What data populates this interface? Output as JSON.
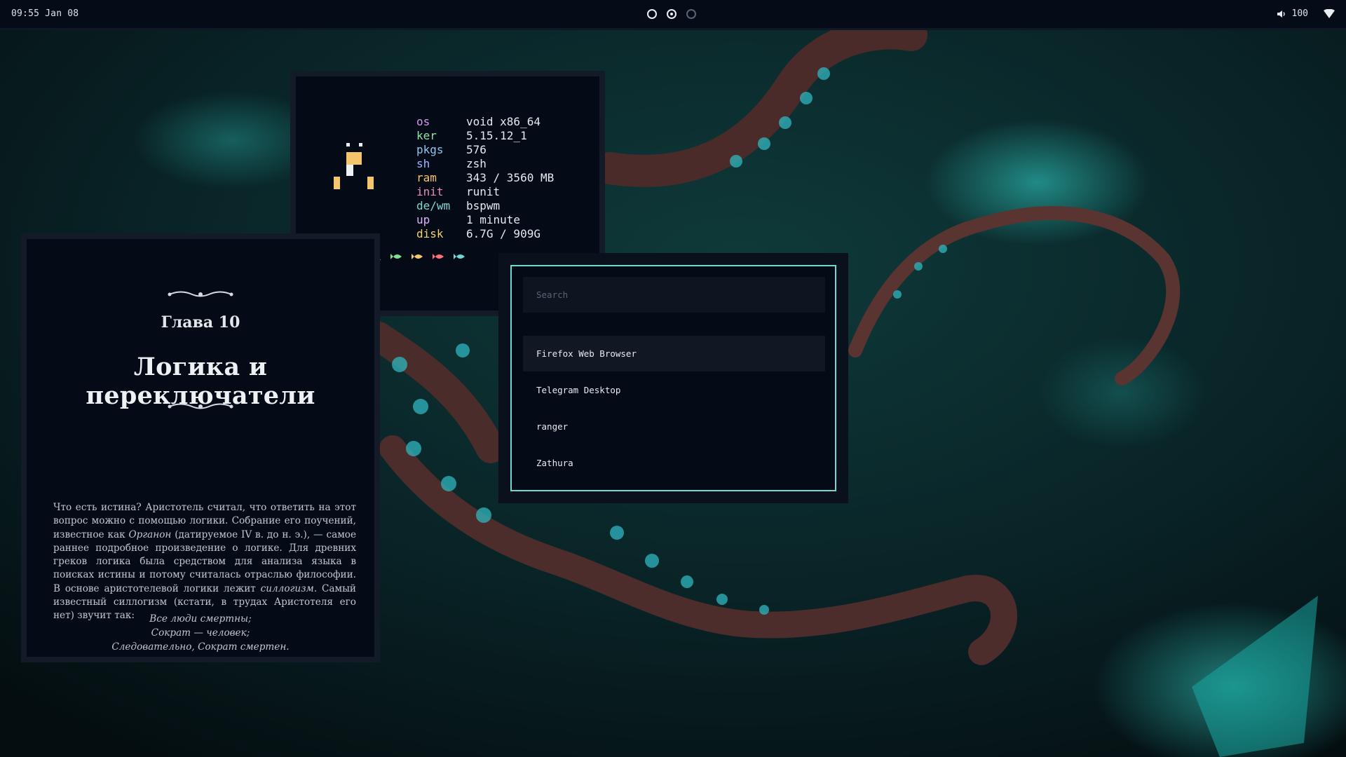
{
  "topbar": {
    "clock": "09:55 Jan 08",
    "volume": "100",
    "workspaces": [
      {
        "state": "occupied"
      },
      {
        "state": "active"
      },
      {
        "state": "empty"
      }
    ],
    "icons": {
      "volume": "speaker-icon",
      "network": "wifi-icon"
    }
  },
  "terminal": {
    "sysinfo": [
      {
        "key": "os",
        "value": "void x86_64"
      },
      {
        "key": "ker",
        "value": "5.15.12_1"
      },
      {
        "key": "pkgs",
        "value": "576"
      },
      {
        "key": "sh",
        "value": "zsh"
      },
      {
        "key": "ram",
        "value": "343 / 3560 MB"
      },
      {
        "key": "init",
        "value": "runit"
      },
      {
        "key": "de/wm",
        "value": "bspwm"
      },
      {
        "key": "up",
        "value": "1 minute"
      },
      {
        "key": "disk",
        "value": "6.7G / 909G"
      }
    ],
    "prompt_dir": "~",
    "prompt_symbol": "⚓",
    "fish_colors": [
      "#7fb3ff",
      "#7fe08f",
      "#f5c56e",
      "#ff6f7d",
      "#6fd8d2"
    ]
  },
  "document": {
    "chapter": "Глава 10",
    "title": "Логика и переключатели",
    "paragraph": {
      "p1": "Что есть истина? Аристотель считал, что ответить на этот вопрос можно с помощью логики. Собрание его поучений, известное как ",
      "em1": "Органон",
      "p2": " (датируемое IV в. до н. э.), — самое раннее подробное произведение о логике. Для древних греков логика была средством для анализа языка в поисках истины и потому считалась отраслью философии. В основе аристотелевой логики лежит ",
      "em2": "силлогизм",
      "p3": ". Самый известный силлогизм (кстати, в трудах Аристотеля его нет) звучит так:"
    },
    "verse": [
      "Все люди смертны;",
      "Сократ — человек;",
      "Следовательно, Сократ смертен."
    ]
  },
  "launcher": {
    "search_placeholder": "Search",
    "items": [
      "Firefox Web Browser",
      "Telegram Desktop",
      "ranger",
      "Zathura"
    ],
    "selected_index": 0,
    "accent": "#6fd8cf"
  },
  "colors": {
    "bar_bg": "#060c17",
    "window_bg": "#050a17",
    "window_border": "#141b28"
  }
}
